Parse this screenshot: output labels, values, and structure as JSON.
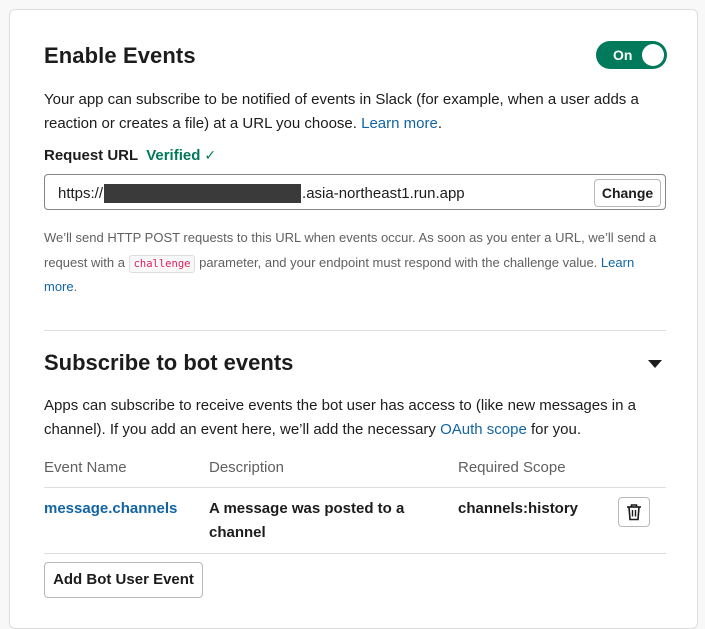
{
  "events": {
    "title": "Enable Events",
    "toggle_label": "On",
    "description": "Your app can subscribe to be notified of events in Slack (for example, when a user adds a reaction or creates a file) at a URL you choose.",
    "learn_more": "Learn more",
    "period": ".",
    "request_url_label": "Request URL",
    "verified_label": "Verified",
    "url_prefix": "https://",
    "url_suffix": ".asia-northeast1.run.app",
    "change_label": "Change",
    "help_part1": "We’ll send HTTP POST requests to this URL when events occur. As soon as you enter a URL, we’ll send a request with a",
    "help_code": "challenge",
    "help_part2": "parameter, and your endpoint must respond with the challenge value.",
    "help_learn_more": "Learn more",
    "help_period": "."
  },
  "bot_events": {
    "title": "Subscribe to bot events",
    "description_part1": "Apps can subscribe to receive events the bot user has access to (like new messages in a channel). If you add an event here, we’ll add the necessary",
    "oauth_scope": "OAuth scope",
    "description_part2": "for you.",
    "columns": {
      "event_name": "Event Name",
      "description": "Description",
      "required_scope": "Required Scope"
    },
    "rows": [
      {
        "event_name": "message.channels",
        "description": "A message was posted to a channel",
        "scope": "channels:history"
      }
    ],
    "add_button": "Add Bot User Event"
  },
  "colors": {
    "accent_green": "#007a5a",
    "link_blue": "#1264a3",
    "code_red": "#e01e5a"
  },
  "icons": {
    "verified": "check-icon",
    "delete": "trash-icon",
    "collapse": "caret-down-icon"
  }
}
